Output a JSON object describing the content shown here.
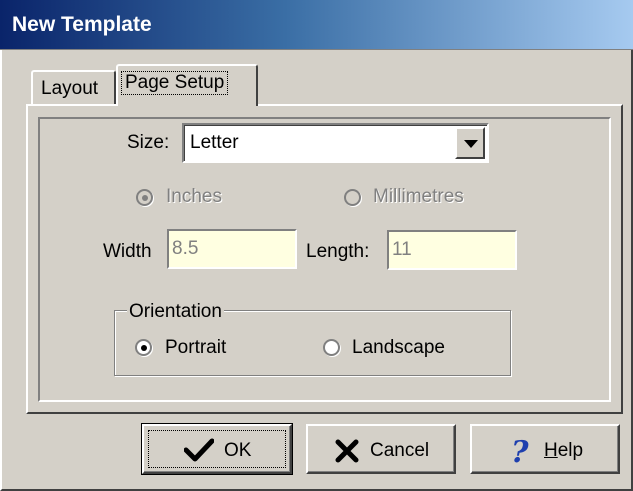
{
  "window": {
    "title": "New Template"
  },
  "tabs": [
    {
      "label": "Layout",
      "selected": false
    },
    {
      "label": "Page Setup",
      "selected": true
    }
  ],
  "size": {
    "label": "Size:",
    "value": "Letter",
    "icon": "chevron-down-icon"
  },
  "units": {
    "inches": {
      "label": "Inches",
      "selected": true,
      "enabled": false
    },
    "millimetres": {
      "label": "Millimetres",
      "selected": false,
      "enabled": false
    }
  },
  "width": {
    "label": "Width",
    "value": "8.5"
  },
  "length": {
    "label": "Length:",
    "value": "11"
  },
  "orientation": {
    "legend": "Orientation",
    "portrait": {
      "label": "Portrait",
      "selected": true
    },
    "landscape": {
      "label": "Landscape",
      "selected": false
    }
  },
  "buttons": {
    "ok": {
      "label": "OK",
      "icon": "checkmark-icon"
    },
    "cancel": {
      "label": "Cancel",
      "icon": "x-icon"
    },
    "help": {
      "label_prefix": "",
      "label_mnemonic": "H",
      "label_rest": "elp",
      "icon": "question-mark-icon"
    }
  },
  "colors": {
    "title_gradient_start": "#0a246a",
    "title_gradient_end": "#a6caf0",
    "face": "#d4d0c8",
    "readonly_field": "#ffffe1",
    "cancel_icon": "#000000",
    "help_icon": "#1e3fae"
  }
}
